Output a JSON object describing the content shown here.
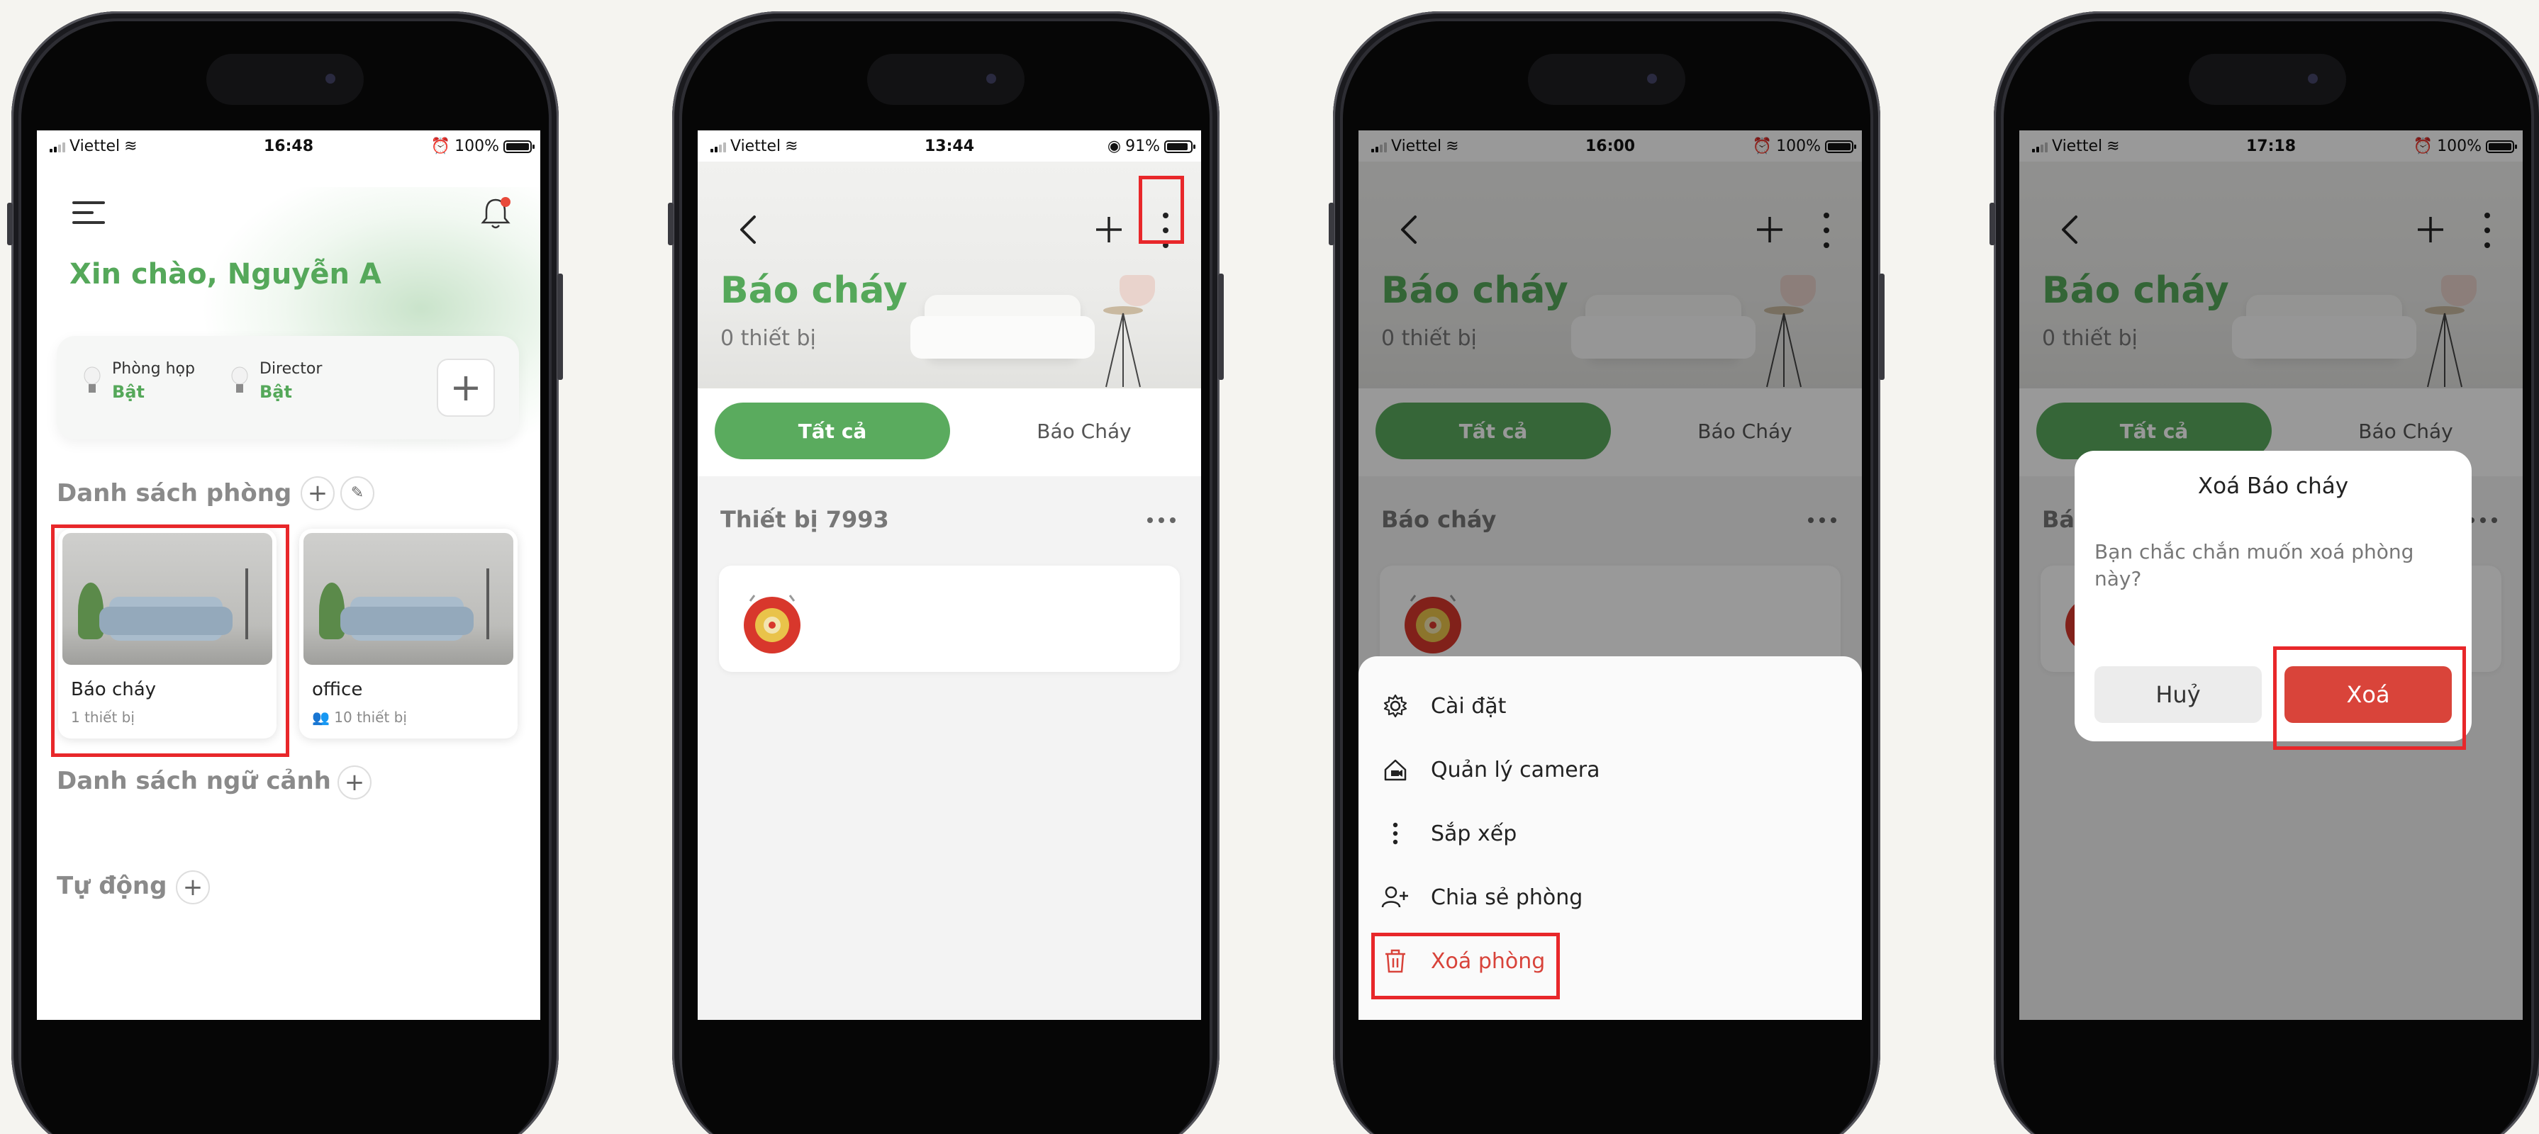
{
  "status_bars": [
    {
      "carrier": "Viettel",
      "time": "16:48",
      "battery": "100%",
      "battery_level": 1.0
    },
    {
      "carrier": "Viettel",
      "time": "13:44",
      "battery": "91%",
      "battery_level": 0.91
    },
    {
      "carrier": "Viettel",
      "time": "16:00",
      "battery": "100%",
      "battery_level": 1.0
    },
    {
      "carrier": "Viettel",
      "time": "17:18",
      "battery": "100%",
      "battery_level": 1.0
    }
  ],
  "home": {
    "greeting": "Xin chào, Nguyễn A",
    "quick_controls": [
      {
        "name": "Phòng họp",
        "state": "Bật"
      },
      {
        "name": "Director",
        "state": "Bật"
      }
    ],
    "rooms_section": "Danh sách phòng",
    "rooms": [
      {
        "name": "Báo cháy",
        "count": "1 thiết bị"
      },
      {
        "name": "office",
        "count": "10 thiết bị"
      }
    ],
    "scenes_section": "Danh sách ngữ cảnh",
    "automation_section": "Tự động"
  },
  "room": {
    "title": "Báo cháy",
    "device_count": "0 thiết bị",
    "tabs": [
      "Tất cả",
      "Báo Cháy"
    ],
    "group_titles": [
      "Thiết bị 7993",
      "Báo cháy",
      "Bá"
    ]
  },
  "menu": {
    "items": [
      {
        "label": "Cài đặt",
        "icon": "gear-icon"
      },
      {
        "label": "Quản lý camera",
        "icon": "home-camera-icon"
      },
      {
        "label": "Sắp xếp",
        "icon": "more-vertical-icon"
      },
      {
        "label": "Chia sẻ phòng",
        "icon": "add-user-icon"
      },
      {
        "label": "Xoá phòng",
        "icon": "trash-icon"
      }
    ]
  },
  "dialog": {
    "title": "Xoá Báo cháy",
    "message": "Bạn chắc chắn muốn xoá phòng này?",
    "cancel": "Huỷ",
    "confirm": "Xoá"
  },
  "colors": {
    "brand_green": "#55a85a",
    "danger_red": "#d8433a",
    "highlight_red": "#e8272a"
  }
}
